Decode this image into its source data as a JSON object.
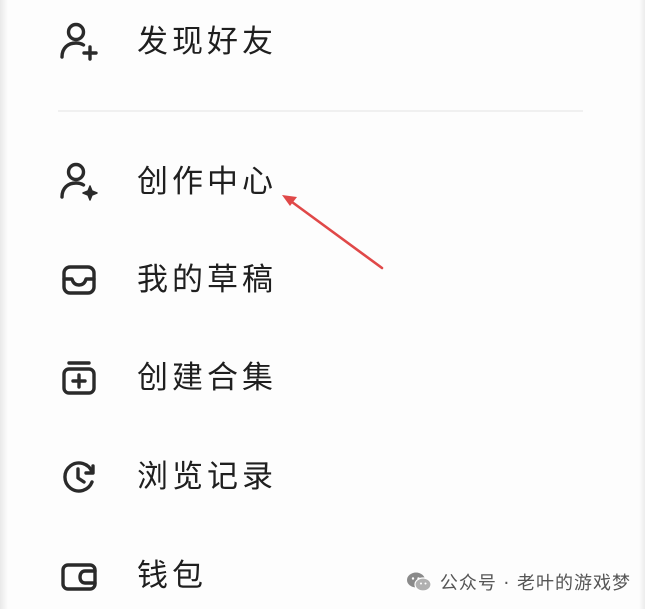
{
  "menu": {
    "items": [
      {
        "label": "发现好友",
        "icon": "add-user-icon"
      },
      {
        "label": "创作中心",
        "icon": "creator-user-icon"
      },
      {
        "label": "我的草稿",
        "icon": "inbox-icon"
      },
      {
        "label": "创建合集",
        "icon": "add-collection-icon"
      },
      {
        "label": "浏览记录",
        "icon": "history-clock-icon"
      },
      {
        "label": "钱包",
        "icon": "wallet-icon"
      }
    ]
  },
  "annotation": {
    "arrow_color": "#e04848"
  },
  "watermark": {
    "text": "公众号 · 老叶的游戏梦",
    "icon": "wechat-icon"
  },
  "colors": {
    "text": "#1f1f1f",
    "icon": "#2a2a2a",
    "background": "#fdfdfd"
  }
}
